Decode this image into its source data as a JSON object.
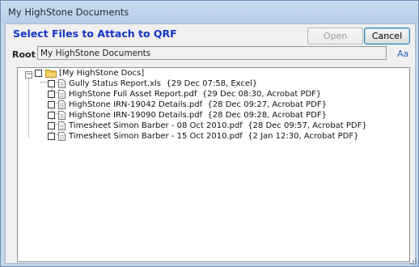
{
  "window": {
    "title": "My HighStone Documents"
  },
  "header": {
    "heading": "Select Files to Attach to QRF"
  },
  "buttons": {
    "open": "Open",
    "cancel": "Cancel"
  },
  "root": {
    "label": "Root",
    "value": "My HighStone Documents",
    "font_link": "Aa"
  },
  "tree": {
    "root_node": {
      "label": "[My HighStone Docs]",
      "expander": "−",
      "icon": "folder-icon"
    },
    "files": [
      {
        "name": "Gully Status Report.xls",
        "meta": "{29 Dec 07:58, Excel}",
        "icon": "document-icon"
      },
      {
        "name": "HighStone Full Asset Report.pdf",
        "meta": "{29 Dec 08:30, Acrobat PDF}",
        "icon": "document-icon"
      },
      {
        "name": "HighStone IRN-19042 Details.pdf",
        "meta": "{28 Dec 09:27, Acrobat PDF}",
        "icon": "document-icon"
      },
      {
        "name": "HighStone IRN-19090 Details.pdf",
        "meta": "{28 Dec 09:28, Acrobat PDF}",
        "icon": "document-icon"
      },
      {
        "name": "Timesheet Simon Barber - 08 Oct 2010.pdf",
        "meta": "{28 Dec 09:57, Acrobat PDF}",
        "icon": "document-icon"
      },
      {
        "name": "Timesheet Simon Barber - 15 Oct 2010.pdf",
        "meta": "{2 Jan 12:30, Acrobat PDF}",
        "icon": "document-icon"
      }
    ]
  },
  "colors": {
    "heading": "#1533c6",
    "title_bar": "#b9cfe8",
    "link": "#2a5fbf"
  }
}
